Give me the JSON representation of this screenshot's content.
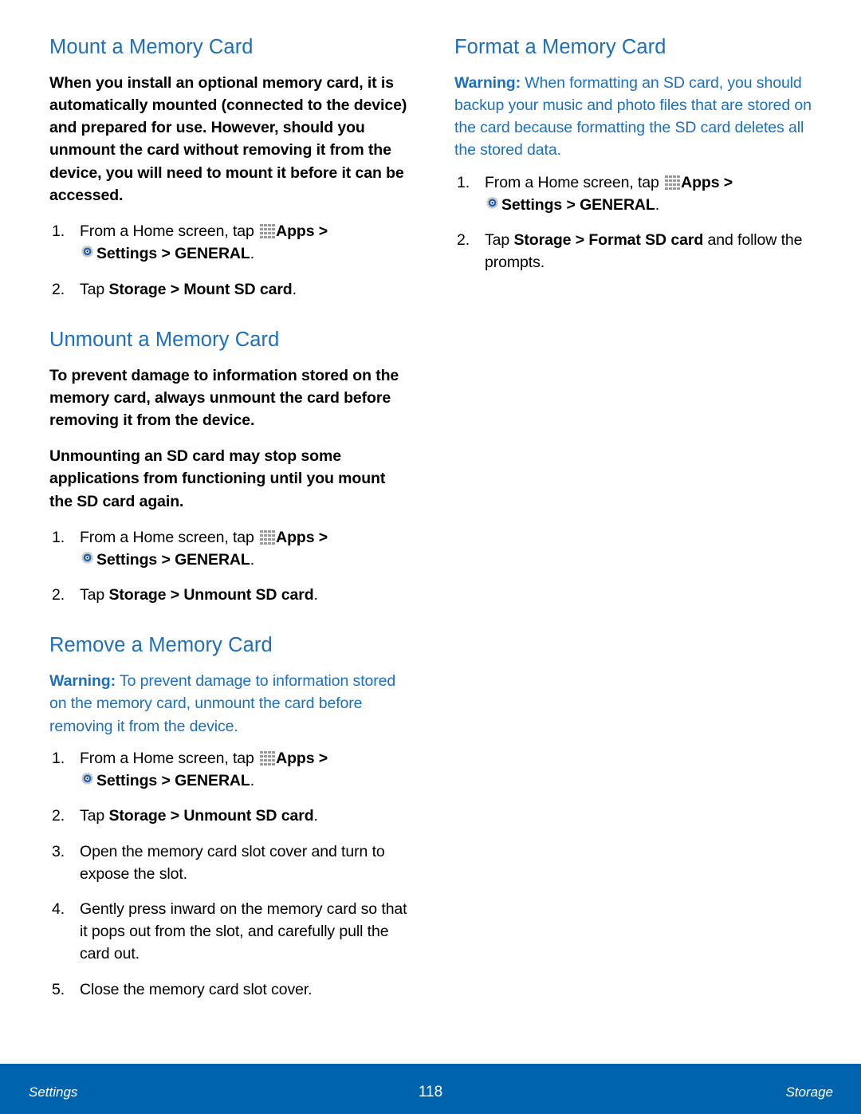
{
  "document": {
    "heading_color": "#1d6fba",
    "footer_color": "#0063ae",
    "body_color": "#000000"
  },
  "left_column": {
    "sections": [
      {
        "heading": "Mount a Memory Card",
        "paragraph": "When you install an optional memory card, it is automatically mounted (connected to the device) and prepared for use. However, should you unmount the card without removing it from the device, you will need to mount it before it can be accessed.",
        "steps": [
          {
            "number": "1.",
            "pre_apps": "From a Home screen, tap",
            "apps_label": "Apps",
            "sep1": ">",
            "settings_label": "Settings",
            "sep2": ">",
            "general_label": "GENERAL",
            "period": "."
          },
          {
            "number": "2.",
            "lead": "Tap",
            "bold1": "Storage",
            "sep": ">",
            "bold2": "Mount SD card",
            "period": "."
          }
        ]
      },
      {
        "heading": "Unmount a Memory Card",
        "paragraph1": "To prevent damage to information stored on the memory card, always unmount the card before removing it from the device.",
        "paragraph2": "Unmounting an SD card may stop some applications from functioning until you mount the SD card again.",
        "steps": [
          {
            "number": "1.",
            "pre_apps": "From a Home screen, tap",
            "apps_label": "Apps",
            "sep1": ">",
            "settings_label": "Settings",
            "sep2": ">",
            "general_label": "GENERAL",
            "period": "."
          },
          {
            "number": "2.",
            "lead": "Tap",
            "bold1": "Storage",
            "sep": ">",
            "bold2": "Unmount SD card",
            "period": "."
          }
        ]
      },
      {
        "heading": "Remove a Memory Card",
        "warning_label": "Warning:",
        "warning_text": " To prevent damage to information stored on the memory card, unmount the card before removing it from the device.",
        "steps": [
          {
            "number": "1.",
            "pre_apps": "From a Home screen, tap",
            "apps_label": "Apps",
            "sep1": ">",
            "settings_label": "Settings",
            "sep2": ">",
            "general_label": "GENERAL",
            "period": "."
          },
          {
            "number": "2.",
            "lead": "Tap",
            "bold1": "Storage",
            "sep": ">",
            "bold2": "Unmount SD card",
            "period": "."
          },
          {
            "number": "3.",
            "text": "Open the memory card slot cover and turn to expose the slot."
          },
          {
            "number": "4.",
            "text": "Gently press inward on the memory card so that it pops out from the slot, and carefully pull the card out."
          },
          {
            "number": "5.",
            "text": "Close the memory card slot cover."
          }
        ]
      }
    ]
  },
  "right_column": {
    "sections": [
      {
        "heading": "Format a Memory Card",
        "warning_label": "Warning:",
        "warning_text": " When formatting an SD card, you should backup your music and photo files that are stored on the card because formatting the SD card deletes all the stored data.",
        "steps": [
          {
            "number": "1.",
            "pre_apps": "From a Home screen, tap",
            "apps_label": "Apps",
            "sep1": ">",
            "settings_label": "Settings",
            "sep2": ">",
            "general_label": "GENERAL",
            "period": "."
          },
          {
            "number": "2.",
            "lead": "Tap",
            "bold1": "Storage",
            "sep": ">",
            "bold2": "Format SD card",
            "tail": " and follow the prompts."
          }
        ]
      }
    ]
  },
  "footer": {
    "left": "Settings",
    "page_number": "118",
    "right": "Storage"
  }
}
